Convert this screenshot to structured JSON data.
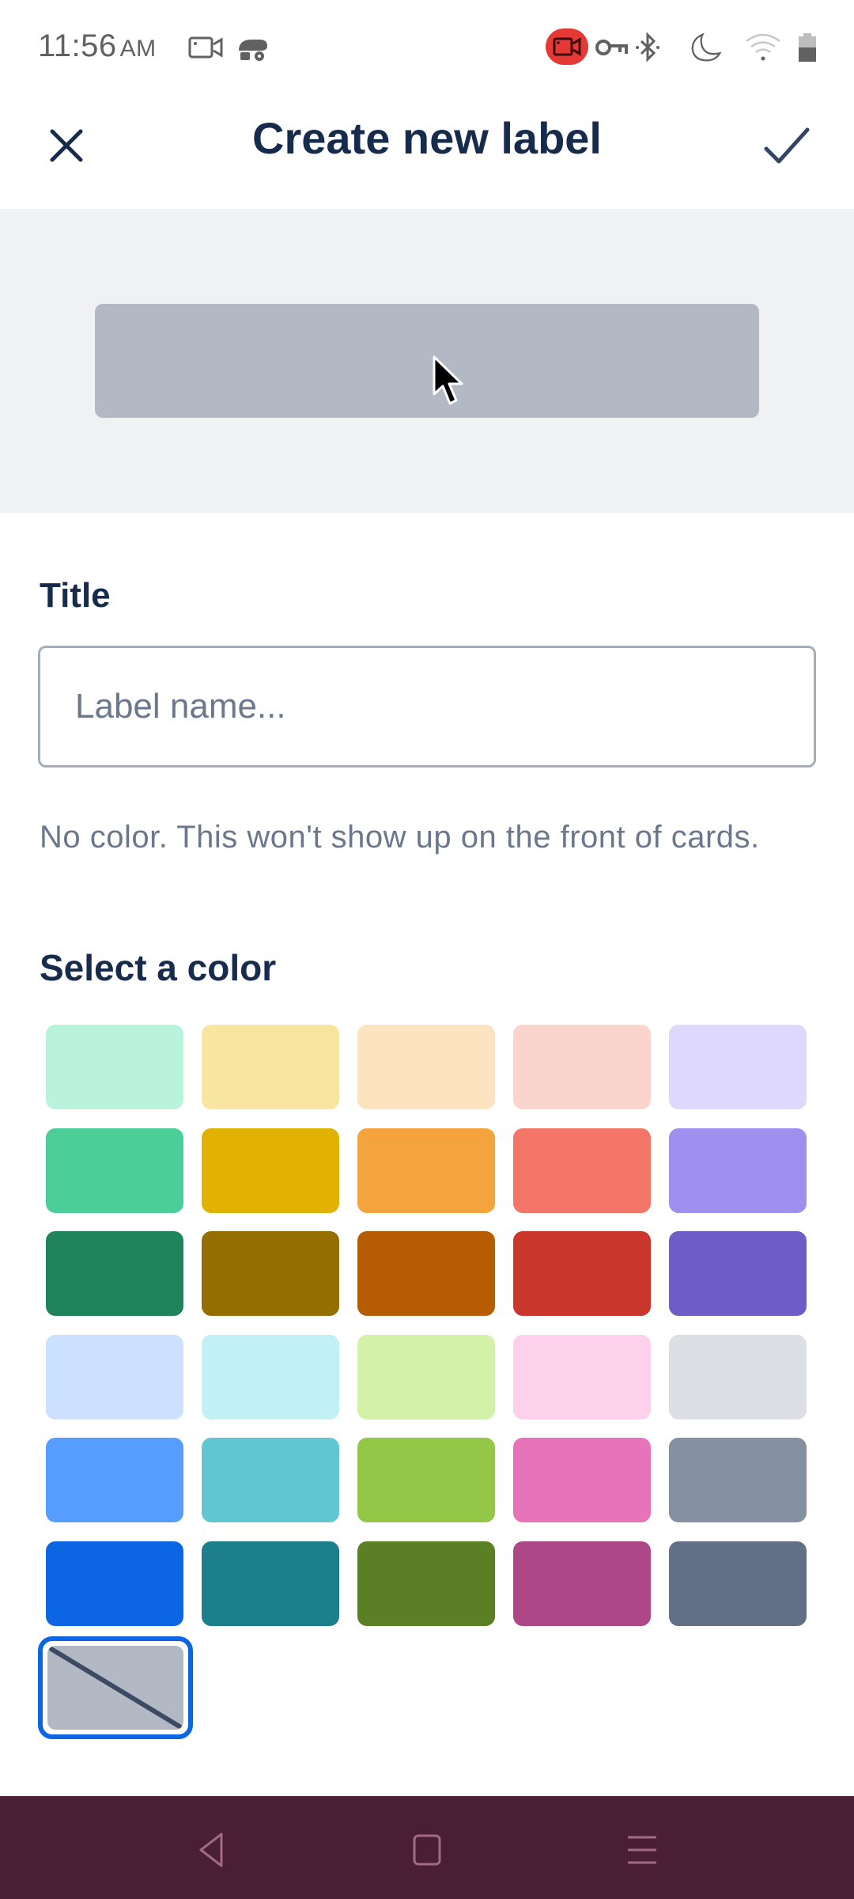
{
  "status_bar": {
    "time": "11:56",
    "ampm": "AM",
    "icons": [
      "screen-record-icon",
      "app-notification-icon",
      "recording-indicator-icon",
      "vpn-key-icon",
      "bluetooth-icon",
      "do-not-disturb-moon-icon",
      "wifi-icon",
      "battery-icon"
    ],
    "recording_color": "#e53935"
  },
  "app_bar": {
    "title": "Create new label",
    "close_icon": "close-icon",
    "confirm_icon": "check-icon"
  },
  "preview": {
    "label_color": "#b3b8c5"
  },
  "form": {
    "title_label": "Title",
    "title_input": {
      "value": "",
      "placeholder": "Label name..."
    },
    "helper_text": "No color. This won't show up on the front of cards.",
    "select_color_label": "Select a color"
  },
  "colors": {
    "rows": [
      [
        "#baf3db",
        "#f8e6a0",
        "#fde3c0",
        "#fad4cd",
        "#dfd8fd"
      ],
      [
        "#4bce97",
        "#e2b203",
        "#f5a33d",
        "#f37669",
        "#9f8fef"
      ],
      [
        "#1f845a",
        "#946f00",
        "#b65c02",
        "#c9372c",
        "#6e5dc6"
      ],
      [
        "#cce0ff",
        "#c1f0f5",
        "#d3f1a7",
        "#fdd0ec",
        "#dcdfe4"
      ],
      [
        "#579dff",
        "#60c6d2",
        "#94c748",
        "#e774bb",
        "#8590a2"
      ],
      [
        "#0c66e4",
        "#1d7f8c",
        "#5b7f24",
        "#ae4787",
        "#626f86"
      ]
    ],
    "no_color": {
      "selected": true,
      "fill": "#b3b8c5",
      "selection_border": "#0c66e4"
    }
  },
  "nav_bar": {
    "background": "#4a1f33",
    "buttons": [
      "back-icon",
      "home-icon",
      "recents-menu-icon"
    ]
  }
}
